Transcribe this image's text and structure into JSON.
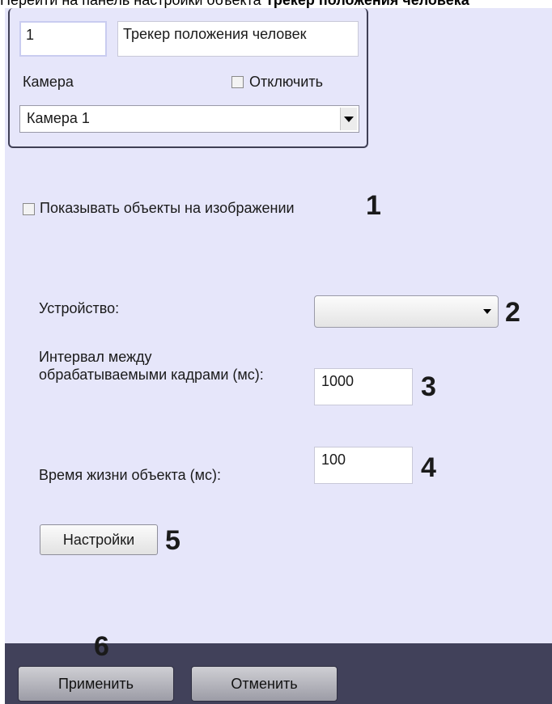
{
  "caption": {
    "prefix": "Перейти на панель настройки объекта ",
    "bold": "Трекер положения человека"
  },
  "camera_group": {
    "id_value": "1",
    "name_value": "Трекер положения человек",
    "camera_label": "Камера",
    "disable_label": "Отключить",
    "camera_selected": "Камера 1"
  },
  "show_objects": {
    "label": "Показывать объекты на изображении",
    "marker": "1"
  },
  "device": {
    "label": "Устройство:",
    "value": "",
    "marker": "2"
  },
  "interval": {
    "label": "Интервал между обрабатываемыми кадрами (мс):",
    "value": "1000",
    "marker": "3"
  },
  "lifetime": {
    "label": "Время жизни объекта (мс):",
    "value": "100",
    "marker": "4"
  },
  "settings": {
    "label": "Настройки",
    "marker": "5"
  },
  "footer": {
    "apply_label": "Применить",
    "cancel_label": "Отменить",
    "marker": "6"
  },
  "colors": {
    "panel_bg": "#e6e6fa",
    "footer_bg": "#41415a",
    "marker": "#1a1a1a"
  }
}
